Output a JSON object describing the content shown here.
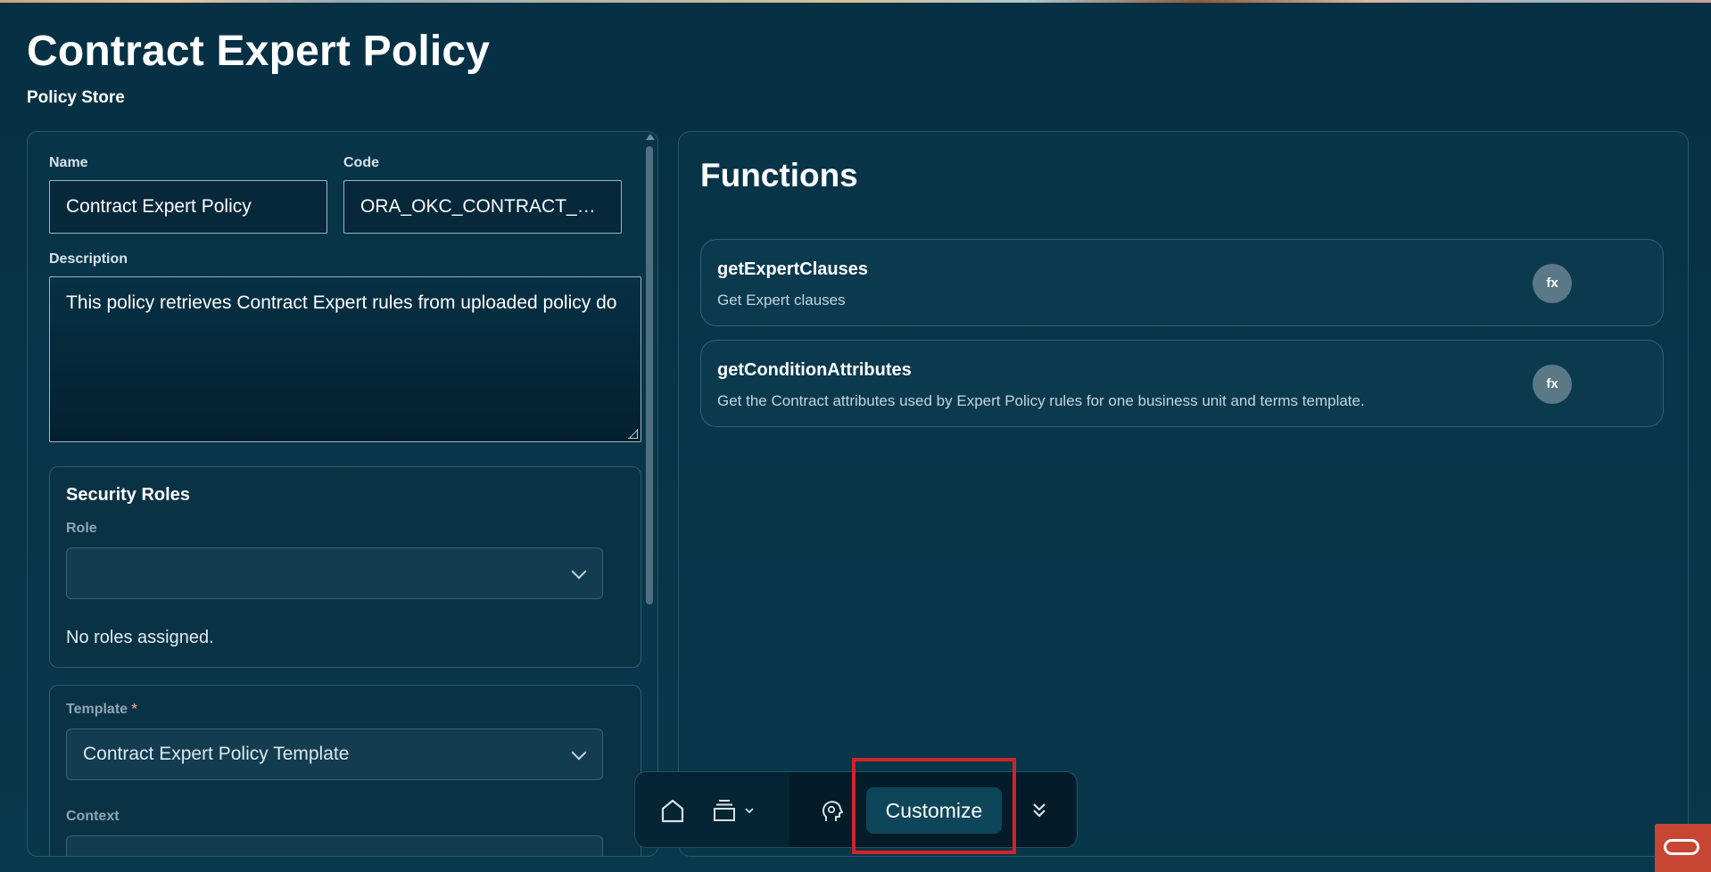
{
  "page": {
    "title": "Contract Expert Policy",
    "subtitle": "Policy Store"
  },
  "form": {
    "name_label": "Name",
    "name_value": "Contract Expert Policy",
    "code_label": "Code",
    "code_value": "ORA_OKC_CONTRACT_EX...",
    "description_label": "Description",
    "description_value": "This policy retrieves Contract Expert rules from uploaded policy do"
  },
  "security_roles": {
    "title": "Security Roles",
    "role_label": "Role",
    "role_value": "",
    "empty_text": "No roles assigned."
  },
  "template": {
    "label": "Template",
    "required_mark": "*",
    "value": "Contract Expert Policy Template",
    "context_label": "Context"
  },
  "functions": {
    "title": "Functions",
    "items": [
      {
        "name": "getExpertClauses",
        "description": "Get Expert clauses",
        "badge": "fx"
      },
      {
        "name": "getConditionAttributes",
        "description": "Get the Contract attributes used by Expert Policy rules for one business unit and terms template.",
        "badge": "fx"
      }
    ]
  },
  "toolbar": {
    "customize_label": "Customize",
    "icons": [
      "home-icon",
      "layers-icon",
      "chevron-down-icon",
      "ai-assistant-icon",
      "double-chevron-down-icon"
    ]
  },
  "colors": {
    "background": "#063044",
    "highlight": "#d2222a",
    "oracle_brand": "#c74634"
  }
}
